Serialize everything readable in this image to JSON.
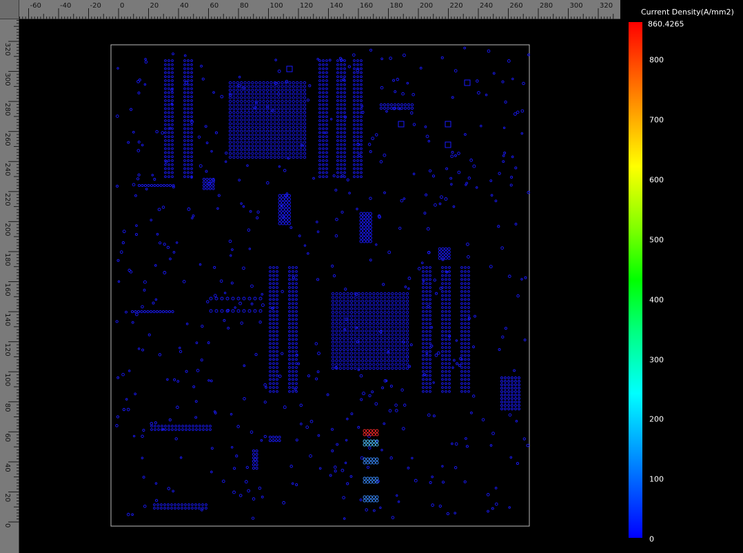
{
  "rulers": {
    "top_labels": [
      "-60",
      "-40",
      "-20",
      "0",
      "20",
      "40",
      "60",
      "80",
      "100",
      "120",
      "140",
      "160",
      "180",
      "200",
      "220",
      "240",
      "260",
      "280",
      "300",
      "320"
    ],
    "left_labels": [
      "320",
      "300",
      "280",
      "260",
      "240",
      "220",
      "200",
      "180",
      "160",
      "140",
      "120",
      "100",
      "80",
      "60",
      "40",
      "20",
      "0"
    ]
  },
  "legend": {
    "title": "Current Density(A/mm2)",
    "max_label": "860.4265",
    "tick_labels": [
      "800",
      "700",
      "600",
      "500",
      "400",
      "300",
      "200",
      "100",
      "0"
    ],
    "colors": {
      "max": "#ff0000",
      "high": "#ffff00",
      "mid": "#00ff00",
      "low_mid": "#00ffff",
      "min": "#0000ff"
    }
  },
  "board": {
    "outline_color": "#bbbbbb",
    "via_color": "#1a1aff",
    "hotspot_color": "#ff2a2a",
    "warm_color": "#4fc3ff"
  }
}
